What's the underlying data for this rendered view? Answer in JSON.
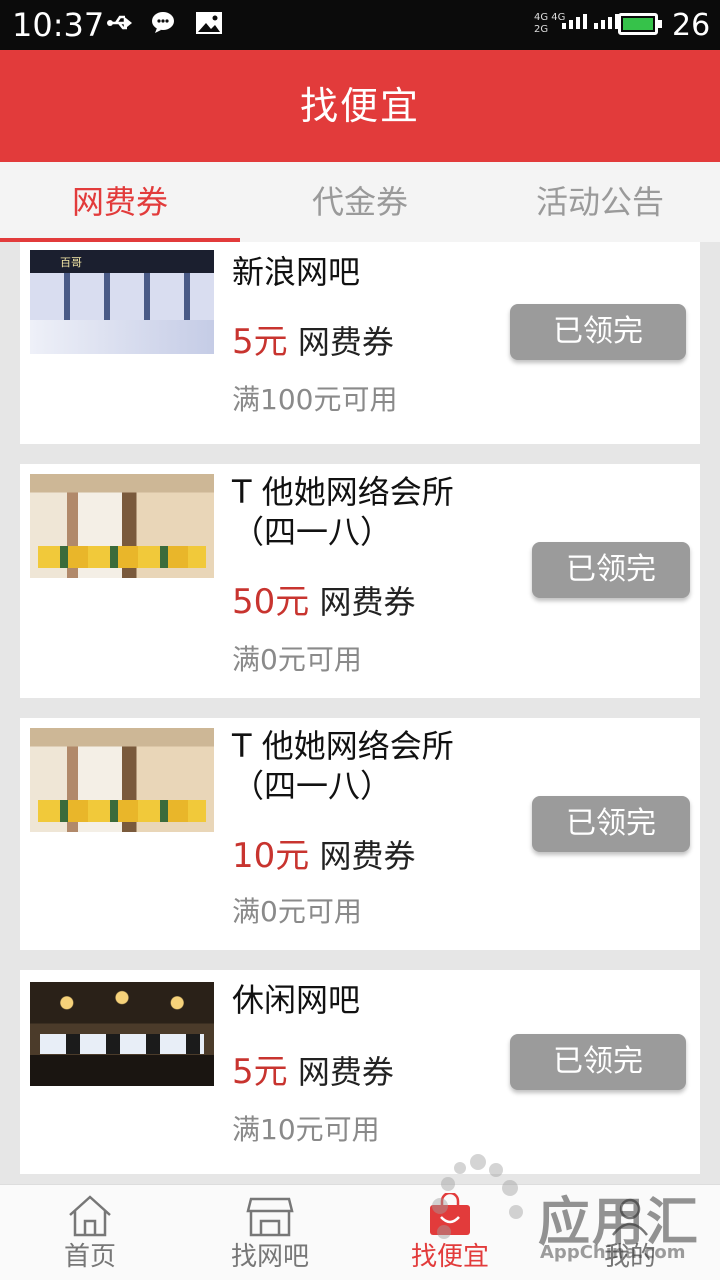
{
  "status_bar": {
    "time": "10:37",
    "network_top": "4G 4G",
    "network_bottom": "2G",
    "battery_level": "26"
  },
  "header": {
    "title": "找便宜"
  },
  "tabs": [
    {
      "label": "网费券",
      "active": true
    },
    {
      "label": "代金券",
      "active": false
    },
    {
      "label": "活动公告",
      "active": false
    }
  ],
  "coupons": [
    {
      "name_line1": "新浪网吧",
      "name_line2": "",
      "amount": "5元",
      "type": "网费券",
      "condition": "满100元可用",
      "button": "已领完",
      "thumb_label": "百哥"
    },
    {
      "name_line1": "T 他她网络会所",
      "name_line2": "（四一八）",
      "amount": "50元",
      "type": "网费券",
      "condition": "满0元可用",
      "button": "已领完"
    },
    {
      "name_line1": "T 他她网络会所",
      "name_line2": "（四一八）",
      "amount": "10元",
      "type": "网费券",
      "condition": "满0元可用",
      "button": "已领完"
    },
    {
      "name_line1": "休闲网吧",
      "name_line2": "",
      "amount": "5元",
      "type": "网费券",
      "condition": "满10元可用",
      "button": "已领完"
    }
  ],
  "bottom_nav": [
    {
      "label": "首页",
      "icon": "home-icon",
      "active": false
    },
    {
      "label": "找网吧",
      "icon": "storefront-icon",
      "active": false
    },
    {
      "label": "找便宜",
      "icon": "gift-bag-icon",
      "active": true
    },
    {
      "label": "我的",
      "icon": "profile-icon",
      "active": false
    }
  ],
  "watermark": {
    "text": "应用汇",
    "sub": "AppChina.com"
  },
  "colors": {
    "accent": "#e23b3b",
    "price": "#c8342f",
    "button_disabled": "#9b9b9b"
  }
}
